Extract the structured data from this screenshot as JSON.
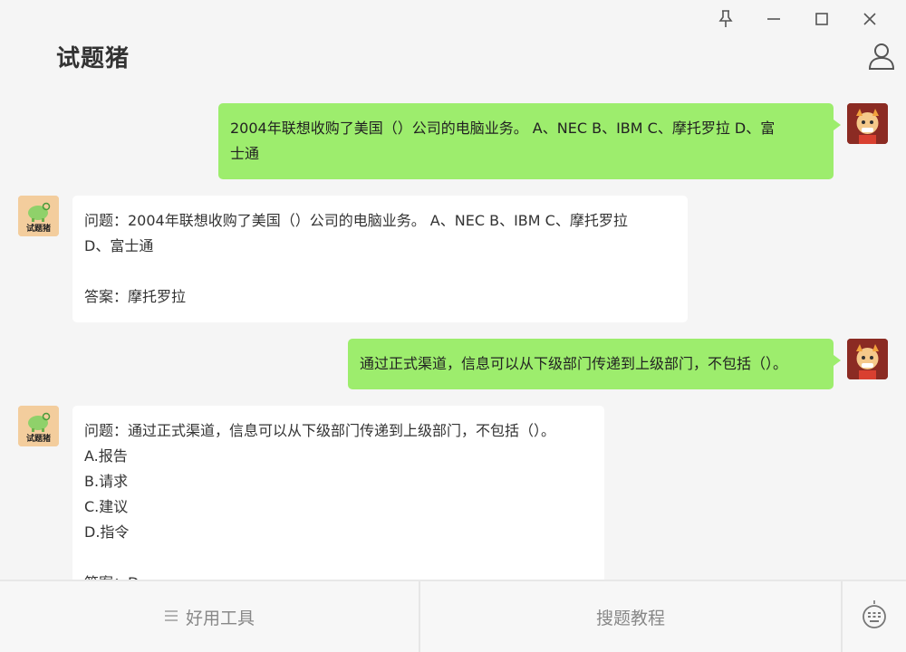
{
  "app": {
    "title": "试题猪"
  },
  "window_controls": {
    "pin": "pin-icon",
    "minimize": "minimize-icon",
    "maximize": "maximize-icon",
    "close": "close-icon"
  },
  "messages": [
    {
      "sender": "user",
      "lines": [
        "2004年联想收购了美国（）公司的电脑业务。 A、NEC B、IBM C、摩托罗拉 D、富",
        "士通"
      ]
    },
    {
      "sender": "bot",
      "lines": [
        "问题：2004年联想收购了美国（）公司的电脑业务。 A、NEC B、IBM C、摩托罗拉",
        "D、富士通",
        "",
        "答案：摩托罗拉"
      ]
    },
    {
      "sender": "user",
      "lines": [
        "通过正式渠道，信息可以从下级部门传递到上级部门，不包括（）。"
      ]
    },
    {
      "sender": "bot",
      "lines": [
        "问题：通过正式渠道，信息可以从下级部门传递到上级部门，不包括（）。",
        "A.报告",
        "B.请求",
        "C.建议",
        "D.指令",
        "",
        "答案：D"
      ]
    }
  ],
  "bot_avatar_label": "试题猪",
  "bottom": {
    "tools_label": "好用工具",
    "tutorial_label": "搜题教程"
  },
  "colors": {
    "user_bubble": "#9ded6d",
    "bot_bubble": "#ffffff",
    "background": "#f5f5f5"
  }
}
